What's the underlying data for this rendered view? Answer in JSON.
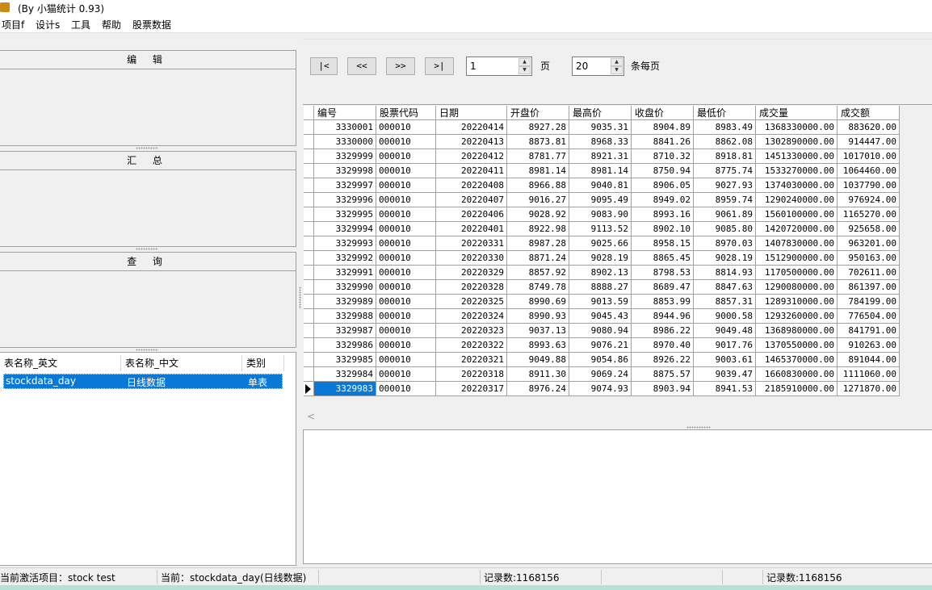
{
  "window": {
    "title": "(By 小猫统计 0.93)"
  },
  "menu": [
    "项目f",
    "设计s",
    "工具",
    "帮助",
    "股票数据"
  ],
  "left_panels": {
    "edit_header": "编 辑",
    "summary_header": "汇 总",
    "query_header": "查 询"
  },
  "tables_list": {
    "columns": [
      "表名称_英文",
      "表名称_中文",
      "类别"
    ],
    "rows": [
      {
        "en": "stockdata_day",
        "cn": "日线数据",
        "type": "单表"
      }
    ]
  },
  "pager": {
    "first": "|<",
    "prev": "<<",
    "next": ">>",
    "last": ">|",
    "page_value": "1",
    "page_label": "页",
    "per_page_value": "20",
    "per_page_label": "条每页"
  },
  "grid": {
    "columns": [
      "编号",
      "股票代码",
      "日期",
      "开盘价",
      "最高价",
      "收盘价",
      "最低价",
      "成交量",
      "成交额"
    ],
    "rows": [
      [
        "3330001",
        "000010",
        "20220414",
        "8927.28",
        "9035.31",
        "8904.89",
        "8983.49",
        "1368330000.00",
        "883620.00"
      ],
      [
        "3330000",
        "000010",
        "20220413",
        "8873.81",
        "8968.33",
        "8841.26",
        "8862.08",
        "1302890000.00",
        "914447.00"
      ],
      [
        "3329999",
        "000010",
        "20220412",
        "8781.77",
        "8921.31",
        "8710.32",
        "8918.81",
        "1451330000.00",
        "1017010.00"
      ],
      [
        "3329998",
        "000010",
        "20220411",
        "8981.14",
        "8981.14",
        "8750.94",
        "8775.74",
        "1533270000.00",
        "1064460.00"
      ],
      [
        "3329997",
        "000010",
        "20220408",
        "8966.88",
        "9040.81",
        "8906.05",
        "9027.93",
        "1374030000.00",
        "1037790.00"
      ],
      [
        "3329996",
        "000010",
        "20220407",
        "9016.27",
        "9095.49",
        "8949.02",
        "8959.74",
        "1290240000.00",
        "976924.00"
      ],
      [
        "3329995",
        "000010",
        "20220406",
        "9028.92",
        "9083.90",
        "8993.16",
        "9061.89",
        "1560100000.00",
        "1165270.00"
      ],
      [
        "3329994",
        "000010",
        "20220401",
        "8922.98",
        "9113.52",
        "8902.10",
        "9085.80",
        "1420720000.00",
        "925658.00"
      ],
      [
        "3329993",
        "000010",
        "20220331",
        "8987.28",
        "9025.66",
        "8958.15",
        "8970.03",
        "1407830000.00",
        "963201.00"
      ],
      [
        "3329992",
        "000010",
        "20220330",
        "8871.24",
        "9028.19",
        "8865.45",
        "9028.19",
        "1512900000.00",
        "950163.00"
      ],
      [
        "3329991",
        "000010",
        "20220329",
        "8857.92",
        "8902.13",
        "8798.53",
        "8814.93",
        "1170500000.00",
        "702611.00"
      ],
      [
        "3329990",
        "000010",
        "20220328",
        "8749.78",
        "8888.27",
        "8689.47",
        "8847.63",
        "1290080000.00",
        "861397.00"
      ],
      [
        "3329989",
        "000010",
        "20220325",
        "8990.69",
        "9013.59",
        "8853.99",
        "8857.31",
        "1289310000.00",
        "784199.00"
      ],
      [
        "3329988",
        "000010",
        "20220324",
        "8990.93",
        "9045.43",
        "8944.96",
        "9000.58",
        "1293260000.00",
        "776504.00"
      ],
      [
        "3329987",
        "000010",
        "20220323",
        "9037.13",
        "9080.94",
        "8986.22",
        "9049.48",
        "1368980000.00",
        "841791.00"
      ],
      [
        "3329986",
        "000010",
        "20220322",
        "8993.63",
        "9076.21",
        "8970.40",
        "9017.76",
        "1370550000.00",
        "910263.00"
      ],
      [
        "3329985",
        "000010",
        "20220321",
        "9049.88",
        "9054.86",
        "8926.22",
        "9003.61",
        "1465370000.00",
        "891044.00"
      ],
      [
        "3329984",
        "000010",
        "20220318",
        "8911.30",
        "9069.24",
        "8875.57",
        "9039.47",
        "1660830000.00",
        "1111060.00"
      ],
      [
        "3329983",
        "000010",
        "20220317",
        "8976.24",
        "9074.93",
        "8903.94",
        "8941.53",
        "2185910000.00",
        "1271870.00"
      ]
    ]
  },
  "status": {
    "project": "当前激活项目：stock test",
    "current": "当前：stockdata_day(日线数据)",
    "records_left": "记录数:1168156",
    "records_right": "记录数:1168156"
  }
}
